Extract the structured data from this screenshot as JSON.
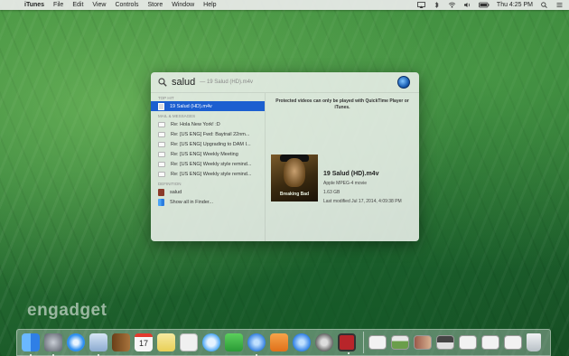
{
  "menubar": {
    "apple": "",
    "app": "iTunes",
    "items": [
      "File",
      "Edit",
      "View",
      "Controls",
      "Store",
      "Window",
      "Help"
    ],
    "clock": "Thu 4:25 PM"
  },
  "spotlight": {
    "query": "salud",
    "completion": "— 19 Salud (HD).m4v",
    "categories": {
      "top_hit": "TOP HIT",
      "mail": "MAIL & MESSAGES",
      "definition": "DEFINITION"
    },
    "top_hit": "19 Salud (HD).m4v",
    "mail_results": [
      "Re: Hola New York! :D",
      "Re: [US ENG] Fwd: Baytrail 22nm...",
      "Re: [US ENG] Upgrading to DAM I...",
      "Re: [US ENG] Weekly Meeting",
      "Re: [US ENG] Weekly style remind...",
      "Re: [US ENG] Weekly style remind..."
    ],
    "definition_result": "salud",
    "show_all": "Show all in Finder...",
    "preview": {
      "protected_msg": "Protected videos can only be played with QuickTime Player or iTunes.",
      "poster_title": "Breaking Bad",
      "file_name": "19 Salud (HD).m4v",
      "kind": "Apple MPEG-4 movie",
      "size": "1.63 GB",
      "last_modified": "Last modified Jul 17, 2014, 4:09:38 PM"
    }
  },
  "watermark": "engadget",
  "dock": {
    "apps": [
      {
        "icon": "finder-icon",
        "color": "#3a8de8"
      },
      {
        "icon": "launchpad-icon",
        "color": "#6a6f7a"
      },
      {
        "icon": "safari-icon",
        "color": "#2f8ff0"
      },
      {
        "icon": "mail-icon",
        "color": "#9bb6d8"
      },
      {
        "icon": "contacts-icon",
        "color": "#8a5a2c"
      },
      {
        "icon": "calendar-icon",
        "color": "#f5f5f5"
      },
      {
        "icon": "notes-icon",
        "color": "#f5e07a"
      },
      {
        "icon": "reminders-icon",
        "color": "#eeeeee"
      },
      {
        "icon": "messages-icon",
        "color": "#4aa6f5"
      },
      {
        "icon": "facetime-icon",
        "color": "#3ab44a"
      },
      {
        "icon": "itunes-icon",
        "color": "#3580e0"
      },
      {
        "icon": "ibooks-icon",
        "color": "#f08a2a"
      },
      {
        "icon": "app-store-icon",
        "color": "#2e7fe6"
      },
      {
        "icon": "system-preferences-icon",
        "color": "#8a8a8a"
      },
      {
        "icon": "photo-booth-icon",
        "color": "#b8252a"
      }
    ],
    "documents": [
      {
        "icon": "document-thumbnail-icon"
      },
      {
        "icon": "document-thumbnail-icon"
      },
      {
        "icon": "document-thumbnail-icon"
      },
      {
        "icon": "document-thumbnail-icon"
      },
      {
        "icon": "document-thumbnail-icon"
      },
      {
        "icon": "document-thumbnail-icon"
      },
      {
        "icon": "document-thumbnail-icon"
      }
    ],
    "trash": {
      "icon": "trash-icon",
      "color": "#d8dde0"
    },
    "calendar_day": "17"
  }
}
